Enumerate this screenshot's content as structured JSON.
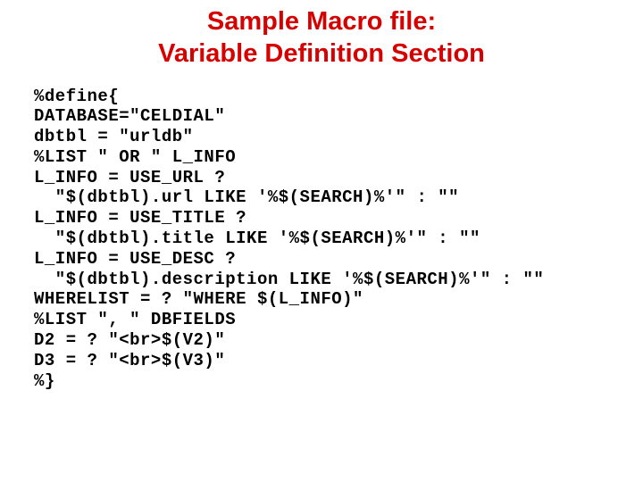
{
  "title_line1": "Sample Macro file:",
  "title_line2": "Variable Definition Section",
  "code_lines": [
    "%define{",
    "DATABASE=\"CELDIAL\"",
    "dbtbl = \"urldb\"",
    "%LIST \" OR \" L_INFO",
    "L_INFO = USE_URL ?",
    "  \"$(dbtbl).url LIKE '%$(SEARCH)%'\" : \"\"",
    "L_INFO = USE_TITLE ?",
    "  \"$(dbtbl).title LIKE '%$(SEARCH)%'\" : \"\"",
    "L_INFO = USE_DESC ?",
    "  \"$(dbtbl).description LIKE '%$(SEARCH)%'\" : \"\"",
    "WHERELIST = ? \"WHERE $(L_INFO)\"",
    "%LIST \", \" DBFIELDS",
    "D2 = ? \"<br>$(V2)\"",
    "D3 = ? \"<br>$(V3)\"",
    "%}"
  ]
}
